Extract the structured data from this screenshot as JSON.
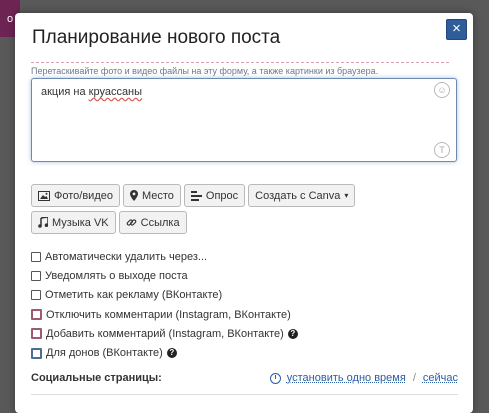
{
  "background": {
    "badge_text": "o"
  },
  "modal": {
    "title": "Планирование нового поста",
    "close_label": "×",
    "drop_hint": "Перетаскивайте фото и видео файлы на эту форму, а также картинки из браузера."
  },
  "editor": {
    "text_prefix": "акция на ",
    "text_misspelled": "круассаны",
    "smile_icon": "smile-icon",
    "text_format_icon": "t-icon"
  },
  "toolbar": {
    "photo_video": "Фото/видео",
    "place": "Место",
    "poll": "Опрос",
    "canva": "Создать с Canva",
    "music_vk": "Музыка VK",
    "link": "Ссылка"
  },
  "options": [
    {
      "label": "Автоматически удалить через...",
      "checked": false
    },
    {
      "label": "Уведомлять о выходе поста",
      "checked": false
    },
    {
      "label": "Отметить как рекламу (ВКонтакте)",
      "checked": false
    },
    {
      "label": "Отключить комментарии (Instagram, ВКонтакте)",
      "checked": false
    },
    {
      "label": "Добавить комментарий (Instagram, ВКонтакте)",
      "checked": false
    },
    {
      "label": "Для донов (ВКонтакте)",
      "checked": false
    }
  ],
  "social": {
    "label": "Социальные страницы:",
    "set_time": "установить одно время",
    "separator": "/",
    "now": "сейчас"
  },
  "colors": {
    "accent": "#2a5da8",
    "close_button": "#2f5d9a",
    "backdrop": "#595959"
  }
}
